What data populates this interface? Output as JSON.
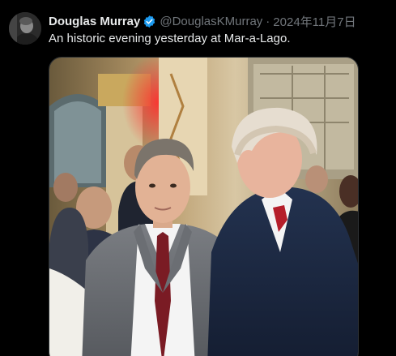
{
  "tweet": {
    "author": {
      "display_name": "Douglas Murray",
      "handle": "@DouglasKMurray",
      "verified_icon": "verified-badge-icon",
      "avatar_icon": "avatar"
    },
    "separator": "·",
    "date": "2024年11月7日",
    "text": "An historic evening yesterday at Mar-a-Lago.",
    "media": {
      "type": "photo"
    }
  },
  "colors": {
    "background": "#000000",
    "text_primary": "#e7e9ea",
    "text_secondary": "#71767b",
    "verified_blue": "#1d9bf0"
  }
}
